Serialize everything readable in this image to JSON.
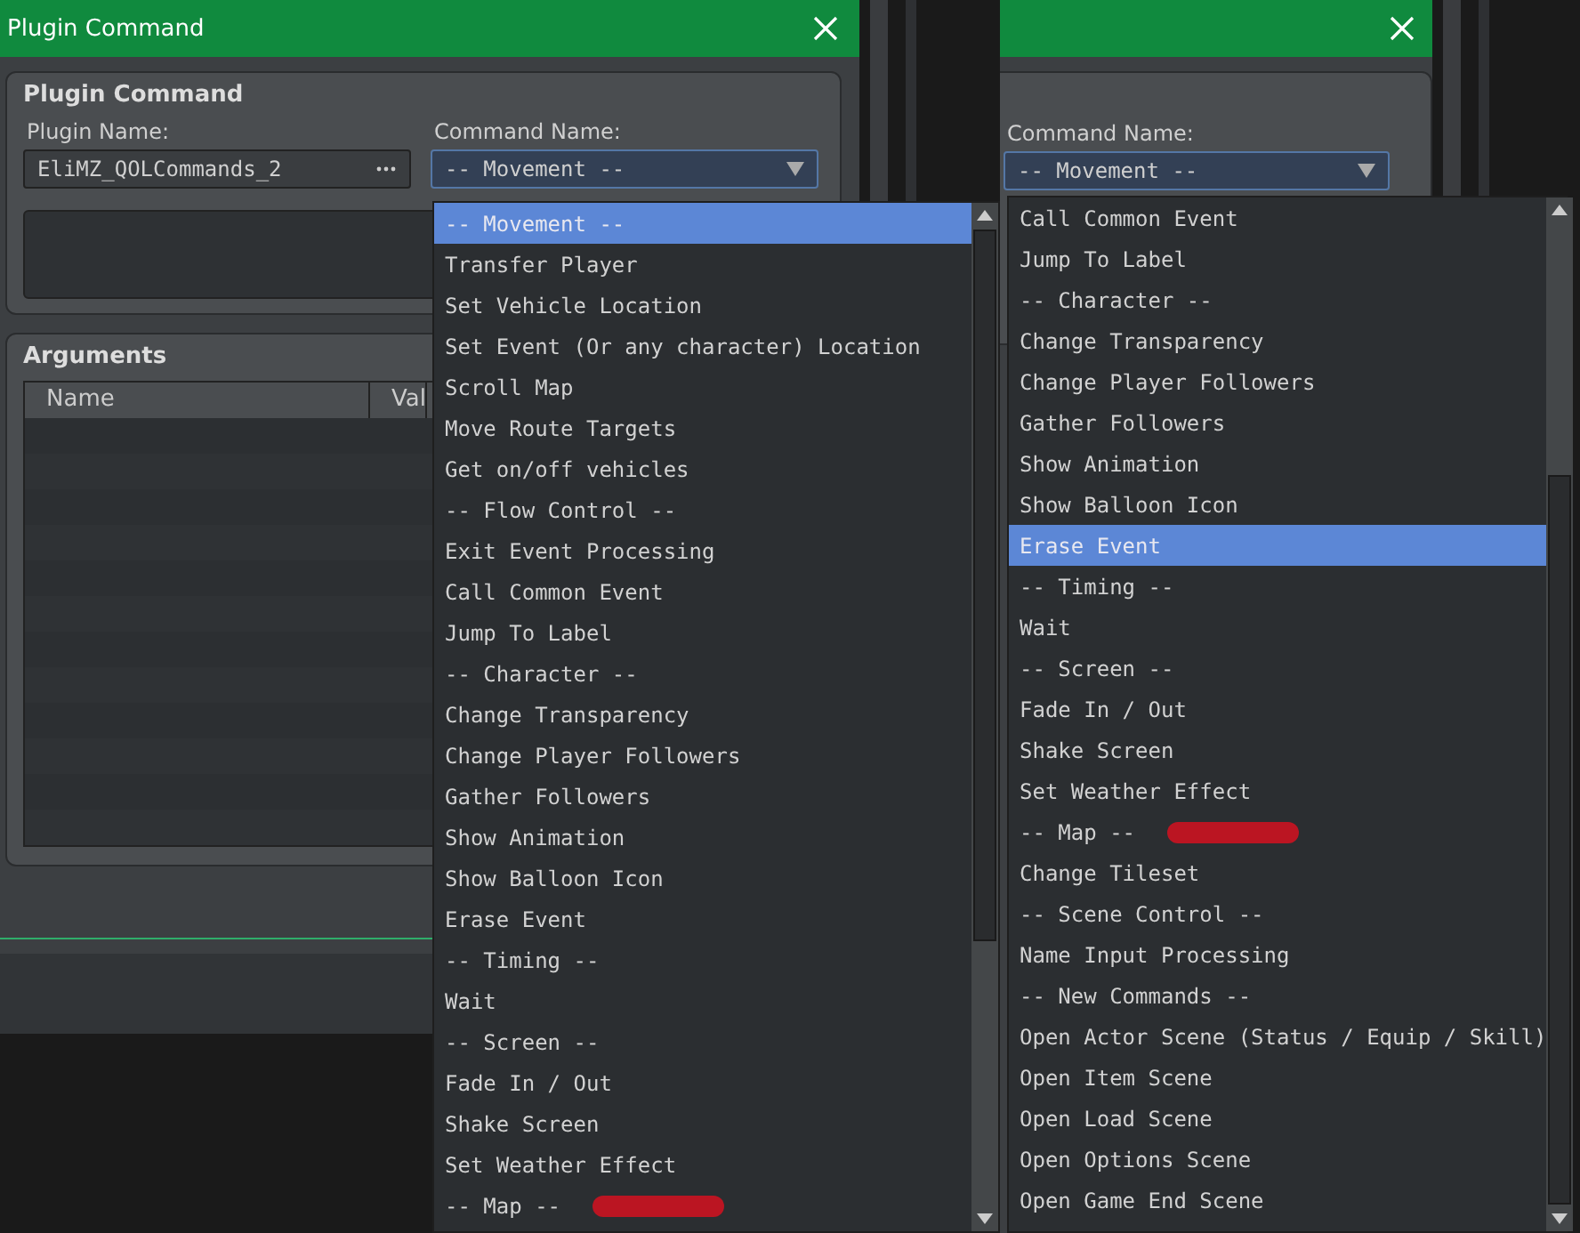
{
  "screens": [
    {
      "window": {
        "title": "Plugin Command"
      },
      "plugin_group": {
        "title": "Plugin Command",
        "plugin_name_label": "Plugin Name:",
        "plugin_name": "EliMZ_QOLCommands_2",
        "command_name_label": "Command Name:",
        "command_name": "-- Movement --"
      },
      "arguments": {
        "title": "Arguments",
        "columns": [
          "Name",
          "Val"
        ]
      },
      "dropdown": {
        "items": [
          {
            "label": "-- Movement --",
            "selected": true
          },
          {
            "label": "Transfer Player",
            "selected": false
          },
          {
            "label": "Set Vehicle Location",
            "selected": false
          },
          {
            "label": "Set Event (Or any character) Location",
            "selected": false
          },
          {
            "label": "Scroll Map",
            "selected": false
          },
          {
            "label": "Move Route Targets",
            "selected": false
          },
          {
            "label": "Get on/off vehicles",
            "selected": false
          },
          {
            "label": "-- Flow Control --",
            "selected": false
          },
          {
            "label": "Exit Event Processing",
            "selected": false
          },
          {
            "label": "Call Common Event",
            "selected": false
          },
          {
            "label": "Jump To Label",
            "selected": false
          },
          {
            "label": "-- Character --",
            "selected": false
          },
          {
            "label": "Change Transparency",
            "selected": false
          },
          {
            "label": "Change Player Followers",
            "selected": false
          },
          {
            "label": "Gather Followers",
            "selected": false
          },
          {
            "label": "Show Animation",
            "selected": false
          },
          {
            "label": "Show Balloon Icon",
            "selected": false
          },
          {
            "label": "Erase Event",
            "selected": false
          },
          {
            "label": "-- Timing --",
            "selected": false
          },
          {
            "label": "Wait",
            "selected": false
          },
          {
            "label": "-- Screen --",
            "selected": false
          },
          {
            "label": "Fade In / Out",
            "selected": false
          },
          {
            "label": "Shake Screen",
            "selected": false
          },
          {
            "label": "Set Weather Effect",
            "selected": false
          },
          {
            "label": "-- Map --",
            "selected": false,
            "redacted": true
          }
        ]
      }
    },
    {
      "plugin_group": {
        "command_name_label": "Command Name:",
        "command_name": "-- Movement --"
      },
      "dropdown": {
        "items": [
          {
            "label": "Call Common Event",
            "selected": false
          },
          {
            "label": "Jump To Label",
            "selected": false
          },
          {
            "label": "-- Character --",
            "selected": false
          },
          {
            "label": "Change Transparency",
            "selected": false
          },
          {
            "label": "Change Player Followers",
            "selected": false
          },
          {
            "label": "Gather Followers",
            "selected": false
          },
          {
            "label": "Show Animation",
            "selected": false
          },
          {
            "label": "Show Balloon Icon",
            "selected": false
          },
          {
            "label": "Erase Event",
            "selected": true
          },
          {
            "label": "-- Timing --",
            "selected": false
          },
          {
            "label": "Wait",
            "selected": false
          },
          {
            "label": "-- Screen --",
            "selected": false
          },
          {
            "label": "Fade In / Out",
            "selected": false
          },
          {
            "label": "Shake Screen",
            "selected": false
          },
          {
            "label": "Set Weather Effect",
            "selected": false
          },
          {
            "label": "-- Map --",
            "selected": false,
            "redacted": true
          },
          {
            "label": "Change Tileset",
            "selected": false
          },
          {
            "label": "-- Scene Control --",
            "selected": false
          },
          {
            "label": "Name Input Processing",
            "selected": false
          },
          {
            "label": "-- New Commands --",
            "selected": false
          },
          {
            "label": "Open Actor Scene (Status / Equip / Skill)",
            "selected": false
          },
          {
            "label": "Open Item Scene",
            "selected": false
          },
          {
            "label": "Open Load Scene",
            "selected": false
          },
          {
            "label": "Open Options Scene",
            "selected": false
          },
          {
            "label": "Open Game End Scene",
            "selected": false
          }
        ]
      }
    }
  ]
}
